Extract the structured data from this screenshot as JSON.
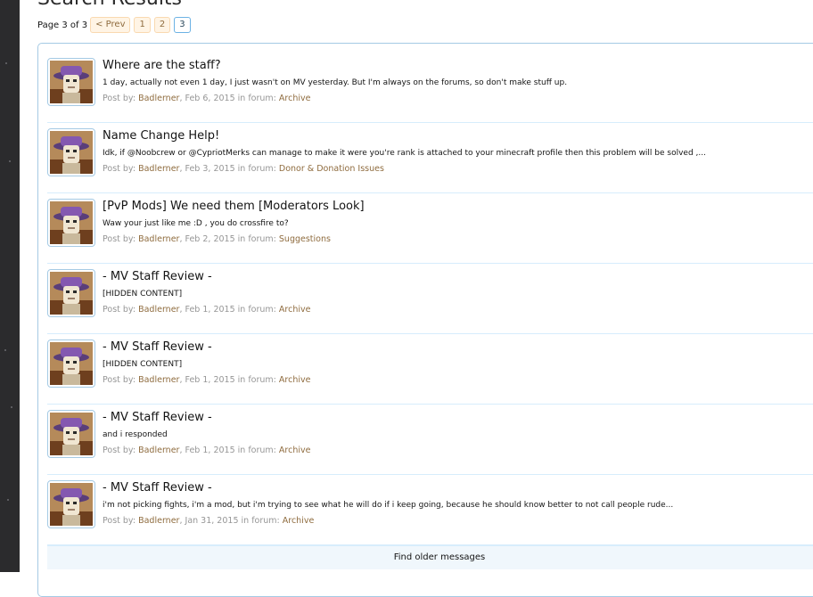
{
  "header": {
    "title": "Search Results"
  },
  "pagination": {
    "label": "Page 3 of 3",
    "prev_label": "< Prev",
    "pages": [
      "1",
      "2",
      "3"
    ],
    "current": "3"
  },
  "meta_labels": {
    "post_by": "Post by:",
    "in_forum": "in forum:"
  },
  "results": [
    {
      "title": "Where are the staff?",
      "snippet": "1 day, actually not even 1 day, I just wasn't on MV yesterday. But I'm always on the forums, so don't make stuff up.",
      "author": "Badlerner",
      "date": "Feb 6, 2015",
      "forum": "Archive"
    },
    {
      "title": "Name Change Help!",
      "snippet": "Idk, if @Noobcrew or @CypriotMerks can manage to make it were you're rank is attached to your minecraft profile then this problem will be solved ,...",
      "author": "Badlerner",
      "date": "Feb 3, 2015",
      "forum": "Donor & Donation Issues"
    },
    {
      "title": "[PvP Mods] We need them [Moderators Look]",
      "snippet": "Waw your just like me :D , you do crossfire to?",
      "author": "Badlerner",
      "date": "Feb 2, 2015",
      "forum": "Suggestions"
    },
    {
      "title": "- MV Staff Review -",
      "snippet": "[HIDDEN CONTENT]",
      "author": "Badlerner",
      "date": "Feb 1, 2015",
      "forum": "Archive"
    },
    {
      "title": "- MV Staff Review -",
      "snippet": "[HIDDEN CONTENT]",
      "author": "Badlerner",
      "date": "Feb 1, 2015",
      "forum": "Archive"
    },
    {
      "title": "- MV Staff Review -",
      "snippet": "and i responded",
      "author": "Badlerner",
      "date": "Feb 1, 2015",
      "forum": "Archive"
    },
    {
      "title": "- MV Staff Review -",
      "snippet": "i'm not picking fights, i'm a mod, but i'm trying to see what he will do if i keep going, because he should know better to not call people rude...",
      "author": "Badlerner",
      "date": "Jan 31, 2015",
      "forum": "Archive"
    }
  ],
  "footer": {
    "older_label": "Find older messages"
  },
  "colors": {
    "border": "#a5cae4",
    "link_brown": "#8f6c3f",
    "muted": "#969696",
    "pagenav_bg": "#fff4e5"
  },
  "icons": {
    "avatar": "user-avatar-image"
  }
}
